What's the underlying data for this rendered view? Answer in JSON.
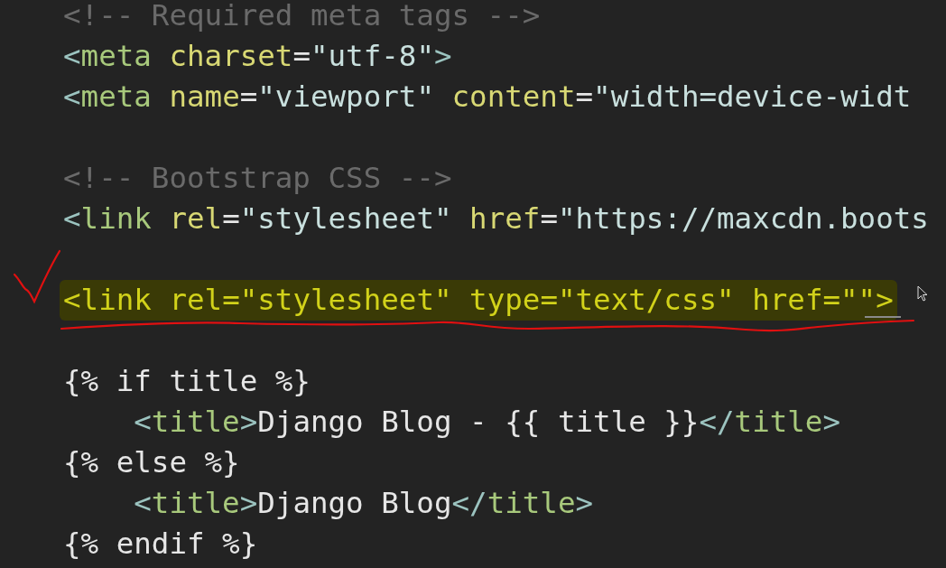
{
  "editor": {
    "lines": [
      {
        "kind": "code",
        "highlighted": false,
        "tokens": [
          {
            "kind": "comment",
            "text": "<!-- Required meta tags -->"
          }
        ]
      },
      {
        "kind": "code",
        "highlighted": false,
        "tokens": [
          {
            "kind": "punct",
            "text": "<"
          },
          {
            "kind": "tag",
            "text": "meta"
          },
          {
            "kind": "attr",
            "text": " charset"
          },
          {
            "kind": "plain",
            "text": "="
          },
          {
            "kind": "string",
            "text": "\"utf-8\""
          },
          {
            "kind": "punct",
            "text": ">"
          }
        ]
      },
      {
        "kind": "code",
        "highlighted": false,
        "tokens": [
          {
            "kind": "punct",
            "text": "<"
          },
          {
            "kind": "tag",
            "text": "meta"
          },
          {
            "kind": "attr",
            "text": " name"
          },
          {
            "kind": "plain",
            "text": "="
          },
          {
            "kind": "string",
            "text": "\"viewport\""
          },
          {
            "kind": "attr",
            "text": " content"
          },
          {
            "kind": "plain",
            "text": "="
          },
          {
            "kind": "string",
            "text": "\"width=device-widt"
          }
        ]
      },
      {
        "kind": "blank"
      },
      {
        "kind": "code",
        "highlighted": false,
        "tokens": [
          {
            "kind": "comment",
            "text": "<!-- Bootstrap CSS -->"
          }
        ]
      },
      {
        "kind": "code",
        "highlighted": false,
        "tokens": [
          {
            "kind": "punct",
            "text": "<"
          },
          {
            "kind": "tag",
            "text": "link"
          },
          {
            "kind": "attr",
            "text": " rel"
          },
          {
            "kind": "plain",
            "text": "="
          },
          {
            "kind": "string",
            "text": "\"stylesheet\""
          },
          {
            "kind": "attr",
            "text": " href"
          },
          {
            "kind": "plain",
            "text": "="
          },
          {
            "kind": "string",
            "text": "\"https://maxcdn.boots"
          }
        ]
      },
      {
        "kind": "blank"
      },
      {
        "kind": "code",
        "highlighted": true,
        "tokens": [
          {
            "kind": "punct",
            "text": "<"
          },
          {
            "kind": "tag",
            "text": "link"
          },
          {
            "kind": "attr",
            "text": " rel"
          },
          {
            "kind": "plain",
            "text": "="
          },
          {
            "kind": "string",
            "text": "\"stylesheet\""
          },
          {
            "kind": "attr",
            "text": " type"
          },
          {
            "kind": "plain",
            "text": "="
          },
          {
            "kind": "string",
            "text": "\"text/css\""
          },
          {
            "kind": "attr",
            "text": " href"
          },
          {
            "kind": "plain",
            "text": "="
          },
          {
            "kind": "string",
            "text": "\"\""
          },
          {
            "kind": "punct",
            "text": ">"
          }
        ]
      },
      {
        "kind": "blank"
      },
      {
        "kind": "code",
        "highlighted": false,
        "tokens": [
          {
            "kind": "template",
            "text": "{% if title %}"
          }
        ],
        "children": [
          {
            "kind": "code",
            "highlighted": false,
            "tokens": [
              {
                "kind": "punct",
                "text": "<"
              },
              {
                "kind": "tag",
                "text": "title"
              },
              {
                "kind": "punct",
                "text": ">"
              },
              {
                "kind": "plain",
                "text": "Django Blog - {{ title }}"
              },
              {
                "kind": "punct",
                "text": "</"
              },
              {
                "kind": "tag",
                "text": "title"
              },
              {
                "kind": "punct",
                "text": ">"
              }
            ]
          }
        ]
      },
      {
        "kind": "code",
        "highlighted": false,
        "tokens": [
          {
            "kind": "template",
            "text": "{% else %}"
          }
        ],
        "children": [
          {
            "kind": "code",
            "highlighted": false,
            "tokens": [
              {
                "kind": "punct",
                "text": "<"
              },
              {
                "kind": "tag",
                "text": "title"
              },
              {
                "kind": "punct",
                "text": ">"
              },
              {
                "kind": "plain",
                "text": "Django Blog"
              },
              {
                "kind": "punct",
                "text": "</"
              },
              {
                "kind": "tag",
                "text": "title"
              },
              {
                "kind": "punct",
                "text": ">"
              }
            ]
          }
        ]
      },
      {
        "kind": "code",
        "highlighted": false,
        "tokens": [
          {
            "kind": "template",
            "text": "{% endif %}"
          }
        ]
      }
    ]
  }
}
